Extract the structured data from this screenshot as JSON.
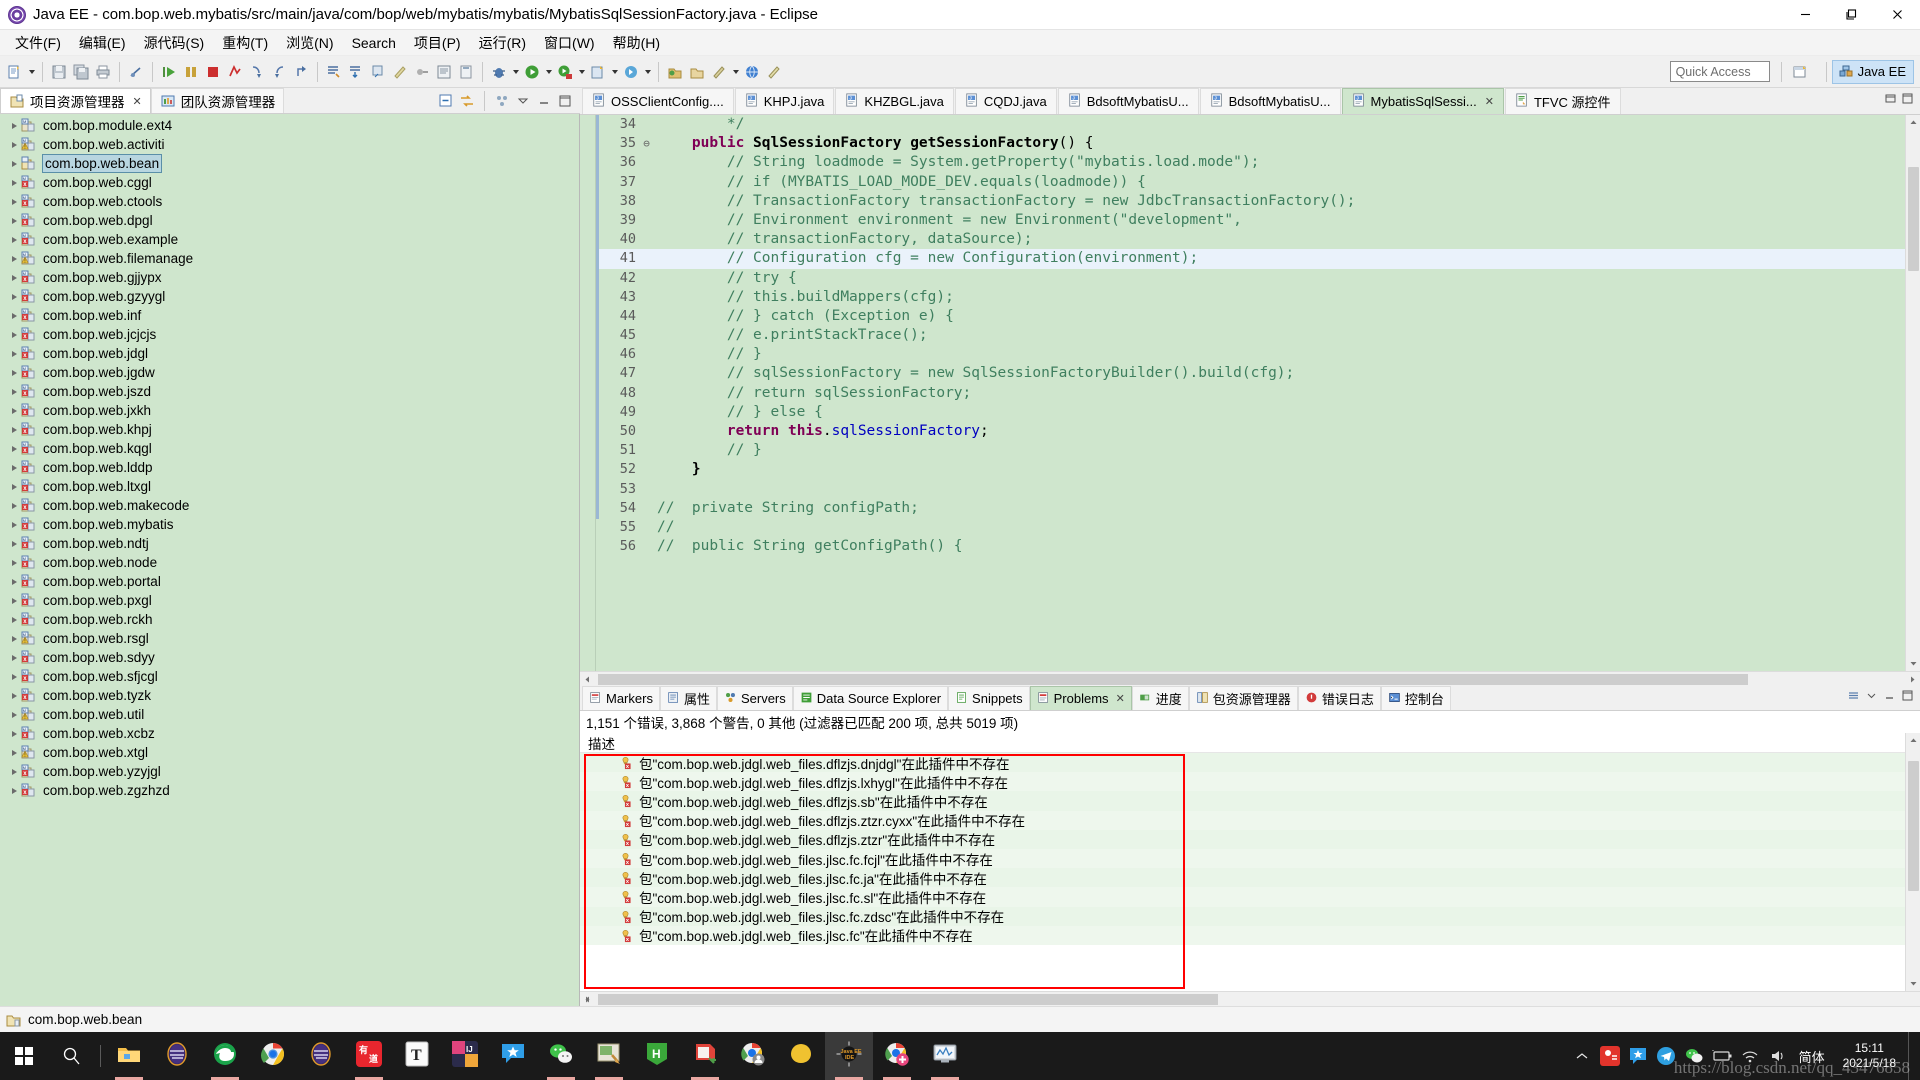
{
  "window": {
    "title": "Java EE  -  com.bop.web.mybatis/src/main/java/com/bop/web/mybatis/mybatis/MybatisSqlSessionFactory.java  -  Eclipse",
    "app_icon": "eclipse-icon",
    "minimize_label": "–",
    "maximize_label": "❐",
    "close_label": "✕"
  },
  "menubar": {
    "items": [
      {
        "label": "文件(F)",
        "name": "menu-file"
      },
      {
        "label": "编辑(E)",
        "name": "menu-edit"
      },
      {
        "label": "源代码(S)",
        "name": "menu-source"
      },
      {
        "label": "重构(T)",
        "name": "menu-refactor"
      },
      {
        "label": "浏览(N)",
        "name": "menu-navigate"
      },
      {
        "label": "Search",
        "name": "menu-search"
      },
      {
        "label": "项目(P)",
        "name": "menu-project"
      },
      {
        "label": "运行(R)",
        "name": "menu-run"
      },
      {
        "label": "窗口(W)",
        "name": "menu-window"
      },
      {
        "label": "帮助(H)",
        "name": "menu-help"
      }
    ]
  },
  "toolbar": {
    "quick_access_placeholder": "Quick Access",
    "quick_access_value": "",
    "perspective_label": "Java EE",
    "open_perspective_icon": "open-perspective-icon",
    "icons": [
      "new-wizard-icon",
      "save-icon",
      "save-all-icon",
      "print-icon",
      "toggle-breakpoint-icon",
      "resume-icon",
      "suspend-icon",
      "terminate-icon",
      "disconnect-icon",
      "step-into-icon",
      "step-over-icon",
      "step-return-icon",
      "open-type-icon",
      "open-task-icon",
      "search-icon",
      "marker-icon",
      "annotation-icon",
      "console-icon",
      "filter-icon",
      "debug-icon",
      "run-icon",
      "run-server-icon",
      "coverage-icon",
      "external-tools-icon",
      "new-java-project-icon",
      "new-class-icon",
      "new-package-icon",
      "next-annotation-icon",
      "prev-annotation-icon",
      "browser-icon"
    ]
  },
  "explorer": {
    "tabs": [
      {
        "label": "项目资源管理器",
        "name": "tab-project-explorer",
        "active": true,
        "icon": "project-explorer-icon",
        "closable": true
      },
      {
        "label": "团队资源管理器",
        "name": "tab-team-explorer",
        "active": false,
        "icon": "team-explorer-icon",
        "closable": false
      }
    ],
    "toolbar_icons": [
      "collapse-all-icon",
      "link-with-editor-icon",
      "view-menu-icon",
      "minimize-icon",
      "maximize-icon"
    ],
    "packages": [
      {
        "label": "com.bop.module.ext4",
        "status": "ok",
        "selected": false
      },
      {
        "label": "com.bop.web.activiti",
        "status": "warn",
        "selected": false
      },
      {
        "label": "com.bop.web.bean",
        "status": "plain",
        "selected": true
      },
      {
        "label": "com.bop.web.cggl",
        "status": "error",
        "selected": false
      },
      {
        "label": "com.bop.web.ctools",
        "status": "error",
        "selected": false
      },
      {
        "label": "com.bop.web.dpgl",
        "status": "error",
        "selected": false
      },
      {
        "label": "com.bop.web.example",
        "status": "error",
        "selected": false
      },
      {
        "label": "com.bop.web.filemanage",
        "status": "warn",
        "selected": false
      },
      {
        "label": "com.bop.web.gjjypx",
        "status": "error",
        "selected": false
      },
      {
        "label": "com.bop.web.gzyygl",
        "status": "error",
        "selected": false
      },
      {
        "label": "com.bop.web.inf",
        "status": "error",
        "selected": false
      },
      {
        "label": "com.bop.web.jcjcjs",
        "status": "error",
        "selected": false
      },
      {
        "label": "com.bop.web.jdgl",
        "status": "error",
        "selected": false
      },
      {
        "label": "com.bop.web.jgdw",
        "status": "error",
        "selected": false
      },
      {
        "label": "com.bop.web.jszd",
        "status": "error",
        "selected": false
      },
      {
        "label": "com.bop.web.jxkh",
        "status": "error",
        "selected": false
      },
      {
        "label": "com.bop.web.khpj",
        "status": "error",
        "selected": false
      },
      {
        "label": "com.bop.web.kqgl",
        "status": "error",
        "selected": false
      },
      {
        "label": "com.bop.web.lddp",
        "status": "error",
        "selected": false
      },
      {
        "label": "com.bop.web.ltxgl",
        "status": "error",
        "selected": false
      },
      {
        "label": "com.bop.web.makecode",
        "status": "error",
        "selected": false
      },
      {
        "label": "com.bop.web.mybatis",
        "status": "error",
        "selected": false
      },
      {
        "label": "com.bop.web.ndtj",
        "status": "error",
        "selected": false
      },
      {
        "label": "com.bop.web.node",
        "status": "error",
        "selected": false
      },
      {
        "label": "com.bop.web.portal",
        "status": "error",
        "selected": false
      },
      {
        "label": "com.bop.web.pxgl",
        "status": "error",
        "selected": false
      },
      {
        "label": "com.bop.web.rckh",
        "status": "error",
        "selected": false
      },
      {
        "label": "com.bop.web.rsgl",
        "status": "warn",
        "selected": false
      },
      {
        "label": "com.bop.web.sdyy",
        "status": "error",
        "selected": false
      },
      {
        "label": "com.bop.web.sfjcgl",
        "status": "error",
        "selected": false
      },
      {
        "label": "com.bop.web.tyzk",
        "status": "error",
        "selected": false
      },
      {
        "label": "com.bop.web.util",
        "status": "warn",
        "selected": false
      },
      {
        "label": "com.bop.web.xcbz",
        "status": "error",
        "selected": false
      },
      {
        "label": "com.bop.web.xtgl",
        "status": "warn",
        "selected": false
      },
      {
        "label": "com.bop.web.yzyjgl",
        "status": "error",
        "selected": false
      },
      {
        "label": "com.bop.web.zgzhzd",
        "status": "error",
        "selected": false
      }
    ]
  },
  "editor": {
    "tabs": [
      {
        "label": "OSSClientConfig....",
        "name": "editor-tab-ossclientconfig",
        "active": false,
        "icon": "java-file-icon",
        "closable": false
      },
      {
        "label": "KHPJ.java",
        "name": "editor-tab-khpj",
        "active": false,
        "icon": "java-file-icon",
        "closable": false
      },
      {
        "label": "KHZBGL.java",
        "name": "editor-tab-khzbgl",
        "active": false,
        "icon": "java-file-icon",
        "closable": false
      },
      {
        "label": "CQDJ.java",
        "name": "editor-tab-cqdj",
        "active": false,
        "icon": "java-file-icon",
        "closable": false
      },
      {
        "label": "BdsoftMybatisU...",
        "name": "editor-tab-bdsoftmybatisu-1",
        "active": false,
        "icon": "java-file-icon",
        "closable": false
      },
      {
        "label": "BdsoftMybatisU...",
        "name": "editor-tab-bdsoftmybatisu-2",
        "active": false,
        "icon": "java-file-icon",
        "closable": false
      },
      {
        "label": "MybatisSqlSessi...",
        "name": "editor-tab-mybatissqlsession",
        "active": true,
        "icon": "java-file-icon",
        "closable": true
      },
      {
        "label": "TFVC 源控件",
        "name": "editor-tab-tfvc",
        "active": false,
        "icon": "tfvc-icon",
        "closable": false
      }
    ],
    "tab_tools": [
      "restore-icon",
      "maximize-icon"
    ],
    "lines": [
      {
        "num": "34",
        "fold": "",
        "highlight": false,
        "segments": [
          {
            "t": "        */",
            "c": "cm"
          }
        ]
      },
      {
        "num": "35",
        "fold": "⊖",
        "highlight": false,
        "segments": [
          {
            "t": "    ",
            "c": ""
          },
          {
            "t": "public",
            "c": "kw"
          },
          {
            "t": " ",
            "c": ""
          },
          {
            "t": "SqlSessionFactory",
            "c": "ty"
          },
          {
            "t": " ",
            "c": ""
          },
          {
            "t": "getSessionFactory",
            "c": "mth"
          },
          {
            "t": "() {",
            "c": ""
          }
        ]
      },
      {
        "num": "36",
        "fold": "",
        "highlight": false,
        "segments": [
          {
            "t": "        // String loadmode = System.getProperty(\"mybatis.load.mode\");",
            "c": "cm"
          }
        ]
      },
      {
        "num": "37",
        "fold": "",
        "highlight": false,
        "segments": [
          {
            "t": "        // if (MYBATIS_LOAD_MODE_DEV.equals(loadmode)) {",
            "c": "cm"
          }
        ]
      },
      {
        "num": "38",
        "fold": "",
        "highlight": false,
        "segments": [
          {
            "t": "        // TransactionFactory transactionFactory = new JdbcTransactionFactory();",
            "c": "cm"
          }
        ]
      },
      {
        "num": "39",
        "fold": "",
        "highlight": false,
        "segments": [
          {
            "t": "        // Environment environment = new Environment(\"development\",",
            "c": "cm"
          }
        ]
      },
      {
        "num": "40",
        "fold": "",
        "highlight": false,
        "segments": [
          {
            "t": "        // transactionFactory, dataSource);",
            "c": "cm"
          }
        ]
      },
      {
        "num": "41",
        "fold": "",
        "highlight": true,
        "segments": [
          {
            "t": "        // Configuration cfg = new Configuration(environment);",
            "c": "cm"
          }
        ]
      },
      {
        "num": "42",
        "fold": "",
        "highlight": false,
        "segments": [
          {
            "t": "        // try {",
            "c": "cm"
          }
        ]
      },
      {
        "num": "43",
        "fold": "",
        "highlight": false,
        "segments": [
          {
            "t": "        // this.buildMappers(cfg);",
            "c": "cm"
          }
        ]
      },
      {
        "num": "44",
        "fold": "",
        "highlight": false,
        "segments": [
          {
            "t": "        // } catch (Exception e) {",
            "c": "cm"
          }
        ]
      },
      {
        "num": "45",
        "fold": "",
        "highlight": false,
        "segments": [
          {
            "t": "        // e.printStackTrace();",
            "c": "cm"
          }
        ]
      },
      {
        "num": "46",
        "fold": "",
        "highlight": false,
        "segments": [
          {
            "t": "        // }",
            "c": "cm"
          }
        ]
      },
      {
        "num": "47",
        "fold": "",
        "highlight": false,
        "segments": [
          {
            "t": "        // sqlSessionFactory = new SqlSessionFactoryBuilder().build(cfg);",
            "c": "cm"
          }
        ]
      },
      {
        "num": "48",
        "fold": "",
        "highlight": false,
        "segments": [
          {
            "t": "        // return sqlSessionFactory;",
            "c": "cm"
          }
        ]
      },
      {
        "num": "49",
        "fold": "",
        "highlight": false,
        "segments": [
          {
            "t": "        // } else {",
            "c": "cm"
          }
        ]
      },
      {
        "num": "50",
        "fold": "",
        "highlight": false,
        "segments": [
          {
            "t": "        ",
            "c": ""
          },
          {
            "t": "return",
            "c": "kw"
          },
          {
            "t": " ",
            "c": ""
          },
          {
            "t": "this",
            "c": "kw"
          },
          {
            "t": ".",
            "c": ""
          },
          {
            "t": "sqlSessionFactory",
            "c": "fld"
          },
          {
            "t": ";",
            "c": ""
          }
        ]
      },
      {
        "num": "51",
        "fold": "",
        "highlight": false,
        "segments": [
          {
            "t": "        // }",
            "c": "cm"
          }
        ]
      },
      {
        "num": "52",
        "fold": "",
        "highlight": false,
        "segments": [
          {
            "t": "    }",
            "c": "ty"
          }
        ]
      },
      {
        "num": "53",
        "fold": "",
        "highlight": false,
        "segments": [
          {
            "t": "",
            "c": ""
          }
        ]
      },
      {
        "num": "54",
        "fold": "",
        "highlight": false,
        "segments": [
          {
            "t": "//  private String configPath;",
            "c": "cm"
          }
        ]
      },
      {
        "num": "55",
        "fold": "",
        "highlight": false,
        "segments": [
          {
            "t": "//",
            "c": "cm"
          }
        ]
      },
      {
        "num": "56",
        "fold": "",
        "highlight": false,
        "segments": [
          {
            "t": "//  public String getConfigPath() {",
            "c": "cm"
          }
        ]
      }
    ]
  },
  "problems": {
    "tabs": [
      {
        "label": "Markers",
        "name": "tab-markers",
        "active": false,
        "icon": "markers-icon",
        "closable": false
      },
      {
        "label": "属性",
        "name": "tab-properties",
        "active": false,
        "icon": "properties-icon",
        "closable": false
      },
      {
        "label": "Servers",
        "name": "tab-servers",
        "active": false,
        "icon": "servers-icon",
        "closable": false
      },
      {
        "label": "Data Source Explorer",
        "name": "tab-data-source-explorer",
        "active": false,
        "icon": "datasource-icon",
        "closable": false
      },
      {
        "label": "Snippets",
        "name": "tab-snippets",
        "active": false,
        "icon": "snippets-icon",
        "closable": false
      },
      {
        "label": "Problems",
        "name": "tab-problems",
        "active": true,
        "icon": "problems-icon",
        "closable": true
      },
      {
        "label": "进度",
        "name": "tab-progress",
        "active": false,
        "icon": "progress-icon",
        "closable": false
      },
      {
        "label": "包资源管理器",
        "name": "tab-package-explorer",
        "active": false,
        "icon": "package-explorer-icon",
        "closable": false
      },
      {
        "label": "错误日志",
        "name": "tab-error-log",
        "active": false,
        "icon": "error-log-icon",
        "closable": false
      },
      {
        "label": "控制台",
        "name": "tab-console",
        "active": false,
        "icon": "console-icon",
        "closable": false
      }
    ],
    "panel_tools": [
      "view-menu-icon",
      "minimize-icon",
      "maximize-icon"
    ],
    "summary": "1,151 个错误, 3,868 个警告, 0 其他 (过滤器已匹配 200 项, 总共 5019 项)",
    "column_header": "描述",
    "rows": [
      {
        "text": "包\"com.bop.web.jdgl.web_files.dflzjs.dnjdgl\"在此插件中不存在",
        "severity": "error"
      },
      {
        "text": "包\"com.bop.web.jdgl.web_files.dflzjs.lxhygl\"在此插件中不存在",
        "severity": "error"
      },
      {
        "text": "包\"com.bop.web.jdgl.web_files.dflzjs.sb\"在此插件中不存在",
        "severity": "error"
      },
      {
        "text": "包\"com.bop.web.jdgl.web_files.dflzjs.ztzr.cyxx\"在此插件中不存在",
        "severity": "error"
      },
      {
        "text": "包\"com.bop.web.jdgl.web_files.dflzjs.ztzr\"在此插件中不存在",
        "severity": "error"
      },
      {
        "text": "包\"com.bop.web.jdgl.web_files.jlsc.fc.fcjl\"在此插件中不存在",
        "severity": "error"
      },
      {
        "text": "包\"com.bop.web.jdgl.web_files.jlsc.fc.ja\"在此插件中不存在",
        "severity": "error"
      },
      {
        "text": "包\"com.bop.web.jdgl.web_files.jlsc.fc.sl\"在此插件中不存在",
        "severity": "error"
      },
      {
        "text": "包\"com.bop.web.jdgl.web_files.jlsc.fc.zdsc\"在此插件中不存在",
        "severity": "error"
      },
      {
        "text": "包\"com.bop.web.jdgl.web_files.jlsc.fc\"在此插件中不存在",
        "severity": "error"
      }
    ],
    "highlight_color": "#ff0000"
  },
  "statusbar": {
    "text": "com.bop.web.bean",
    "icon": "package-icon"
  },
  "taskbar": {
    "start_icon": "windows-start-icon",
    "search_icon": "search-icon",
    "items": [
      {
        "name": "taskbar-file-explorer",
        "icon": "file-explorer-icon",
        "running": true,
        "active": false
      },
      {
        "name": "taskbar-eclipse-1",
        "icon": "eclipse-icon",
        "running": false,
        "active": false
      },
      {
        "name": "taskbar-edge",
        "icon": "edge-icon",
        "running": true,
        "active": false
      },
      {
        "name": "taskbar-chrome",
        "icon": "chrome-icon",
        "running": false,
        "active": false
      },
      {
        "name": "taskbar-eclipse-2",
        "icon": "eclipse-icon",
        "running": false,
        "active": false
      },
      {
        "name": "taskbar-youdao",
        "icon": "youdao-icon",
        "running": true,
        "active": false
      },
      {
        "name": "taskbar-typora",
        "icon": "typora-icon",
        "running": false,
        "active": false
      },
      {
        "name": "taskbar-intellij",
        "icon": "intellij-icon",
        "running": false,
        "active": false
      },
      {
        "name": "taskbar-zeplin",
        "icon": "zeplin-icon",
        "running": false,
        "active": false
      },
      {
        "name": "taskbar-wechat",
        "icon": "wechat-icon",
        "running": true,
        "active": false
      },
      {
        "name": "taskbar-snipaste",
        "icon": "snipaste-icon",
        "running": true,
        "active": false
      },
      {
        "name": "taskbar-hbuilder",
        "icon": "hbuilder-icon",
        "running": false,
        "active": false
      },
      {
        "name": "taskbar-notepadpp",
        "icon": "notepadpp-icon",
        "running": true,
        "active": false
      },
      {
        "name": "taskbar-chrome-2",
        "icon": "chrome-user-icon",
        "running": false,
        "active": false
      },
      {
        "name": "taskbar-app-yellow",
        "icon": "yellow-app-icon",
        "running": false,
        "active": false
      },
      {
        "name": "taskbar-eclipse-javaee",
        "icon": "eclipse-javaee-icon",
        "running": true,
        "active": true
      },
      {
        "name": "taskbar-chrome-3",
        "icon": "chrome-plus-icon",
        "running": true,
        "active": false
      },
      {
        "name": "taskbar-monitor",
        "icon": "monitor-icon",
        "running": true,
        "active": false
      }
    ],
    "tray": {
      "chevron": "chevron-up-icon",
      "icons": [
        "qq-icon",
        "snipaste-tray-icon",
        "telegram-icon",
        "wechat-tray-icon",
        "battery-icon",
        "network-icon",
        "volume-icon"
      ],
      "ime_label": "简体",
      "time": "15:11",
      "date": "2021/5/18"
    },
    "watermark": "https://blog.csdn.net/qq_43476858"
  }
}
